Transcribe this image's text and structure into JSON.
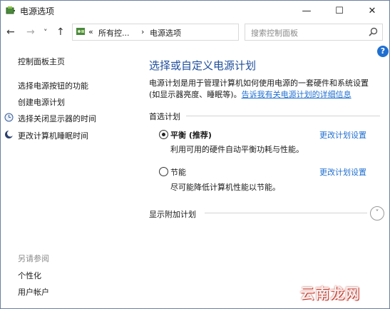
{
  "window": {
    "title": "电源选项",
    "controls": {
      "minimize": "—",
      "maximize": "☐",
      "close": "✕"
    }
  },
  "nav": {
    "back": "←",
    "forward": "→",
    "recent": "˅",
    "up": "↑",
    "breadcrumb": {
      "overflow": "«",
      "items": [
        "所有控...",
        "电源选项"
      ],
      "separator": "›"
    },
    "dropdown": "˅",
    "refresh": "↻"
  },
  "search": {
    "placeholder": "搜索控制面板"
  },
  "help": {
    "label": "?"
  },
  "sidebar": {
    "items": [
      {
        "label": "控制面板主页"
      },
      {
        "label": "选择电源按钮的功能"
      },
      {
        "label": "创建电源计划"
      },
      {
        "label": "选择关闭显示器的时间"
      },
      {
        "label": "更改计算机睡眠时间"
      }
    ],
    "see_also": {
      "heading": "另请参阅",
      "items": [
        {
          "label": "个性化"
        },
        {
          "label": "用户帐户"
        }
      ]
    }
  },
  "main": {
    "heading": "选择或自定义电源计划",
    "description": "电源计划是用于管理计算机如何使用电源的一套硬件和系统设置(如显示器亮度、睡眠等)。",
    "description_link": "告诉我有关电源计划的详细信息",
    "preferred_section": "首选计划",
    "plans": [
      {
        "name": "平衡 (推荐)",
        "selected": true,
        "description": "利用可用的硬件自动平衡功耗与性能。",
        "link": "更改计划设置"
      },
      {
        "name": "节能",
        "selected": false,
        "description": "尽可能降低计算机性能以节能。",
        "link": "更改计划设置"
      }
    ],
    "additional_section": "显示附加计划",
    "expand": "˅"
  },
  "watermark": "云南龙网",
  "colors": {
    "link": "#1f6fd0",
    "heading": "#1e4e9c",
    "help": "#1f6fd0"
  }
}
